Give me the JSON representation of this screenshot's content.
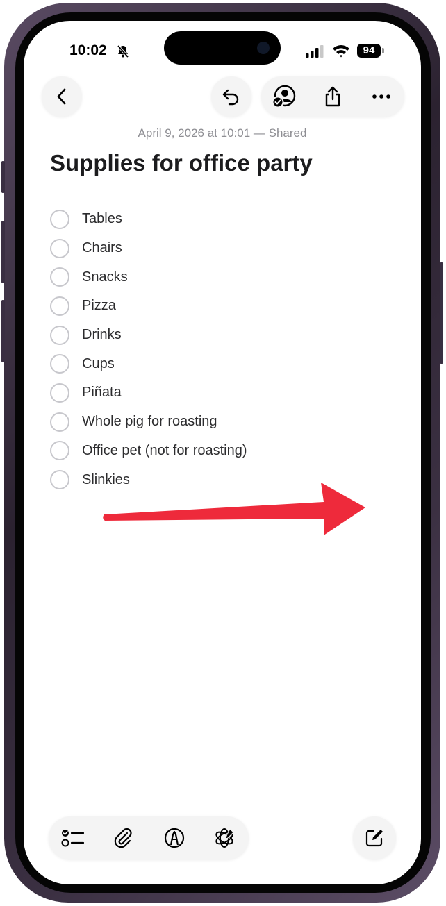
{
  "status_bar": {
    "time": "10:02",
    "battery": "94",
    "icons": [
      "bell-slash-icon",
      "cellular-signal-icon",
      "wifi-icon",
      "battery-icon"
    ]
  },
  "toolbar": {
    "icons": [
      "chevron-left-icon",
      "undo-icon",
      "collaborate-person-icon",
      "share-icon",
      "ellipsis-icon"
    ]
  },
  "note": {
    "timestamp": "April 9, 2026 at 10:01 — Shared",
    "title": "Supplies for office party",
    "items": [
      "Tables",
      "Chairs",
      "Snacks",
      "Pizza",
      "Drinks",
      "Cups",
      "Piñata",
      "Whole pig for roasting",
      "Office pet (not for roasting)",
      "Slinkies"
    ]
  },
  "annotation": {
    "arrow_color": "#ee2a3b",
    "arrow_icon": "red-arrow-right-icon"
  },
  "bottom_bar": {
    "icons": [
      "checklist-icon",
      "paperclip-icon",
      "markup-pen-icon",
      "writing-tools-icon",
      "compose-icon"
    ]
  },
  "colors": {
    "accent": "#000000",
    "placeholder_gray": "#8e8e93",
    "check_circle": "#c7c7cc"
  }
}
